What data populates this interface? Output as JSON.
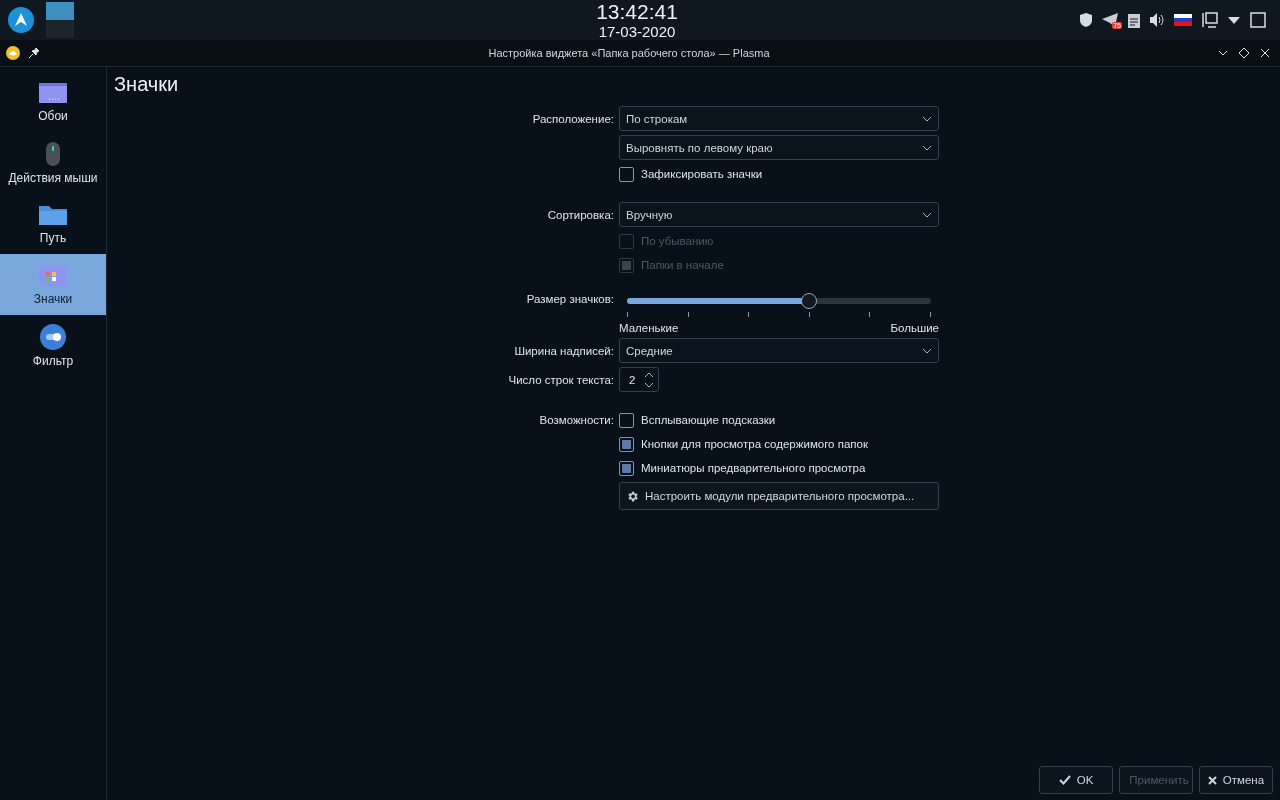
{
  "panel": {
    "time": "13:42:41",
    "date": "17-03-2020",
    "tray_badge": "75"
  },
  "window": {
    "title": "Настройка виджета «Папка рабочего стола» — Plasma"
  },
  "sidebar": {
    "items": [
      {
        "kind": "wallpaper",
        "label": "Обои",
        "selected": false
      },
      {
        "kind": "mouse",
        "label": "Действия мыши",
        "selected": false
      },
      {
        "kind": "folder",
        "label": "Путь",
        "selected": false
      },
      {
        "kind": "icons",
        "label": "Значки",
        "selected": true
      },
      {
        "kind": "filter",
        "label": "Фильтр",
        "selected": false
      }
    ]
  },
  "page_title": "Значки",
  "groups": [
    {
      "rows": [
        {
          "kind": "combo",
          "label": "Расположение:",
          "value": "По строкам"
        },
        {
          "kind": "combo",
          "value": "Выровнять по левому краю"
        },
        {
          "kind": "checkbox",
          "text": "Зафиксировать значки",
          "checked": false,
          "disabled": false
        }
      ]
    },
    {
      "rows": [
        {
          "kind": "combo",
          "label": "Сортировка:",
          "value": "Вручную"
        },
        {
          "kind": "checkbox",
          "text": "По убыванию",
          "checked": false,
          "disabled": true
        },
        {
          "kind": "checkbox",
          "text": "Папки в начале",
          "checked": true,
          "disabled": true
        }
      ]
    },
    {
      "rows": [
        {
          "kind": "slider",
          "label": "Размер значков:",
          "level": 0.6,
          "min_label": "Маленькие",
          "max_label": "Большие"
        },
        {
          "kind": "combo",
          "label": "Ширина надписей:",
          "value": "Средние"
        },
        {
          "kind": "spin",
          "label": "Число строк текста:",
          "value": "2"
        }
      ]
    },
    {
      "rows": [
        {
          "kind": "checkbox",
          "label": "Возможности:",
          "text": "Всплывающие подсказки",
          "checked": false,
          "disabled": false
        },
        {
          "kind": "checkbox",
          "text": "Кнопки для просмотра содержимого папок",
          "checked": true,
          "disabled": false
        },
        {
          "kind": "checkbox",
          "text": "Миниатюры предварительного просмотра",
          "checked": true,
          "disabled": false
        },
        {
          "kind": "button",
          "text": "Настроить модули предварительного просмотра..."
        }
      ]
    }
  ],
  "buttons": [
    {
      "kind": "ok",
      "label": "OK",
      "disabled": false
    },
    {
      "kind": "apply",
      "label": "Применить",
      "disabled": true
    },
    {
      "kind": "cancel",
      "label": "Отмена",
      "disabled": false
    }
  ]
}
